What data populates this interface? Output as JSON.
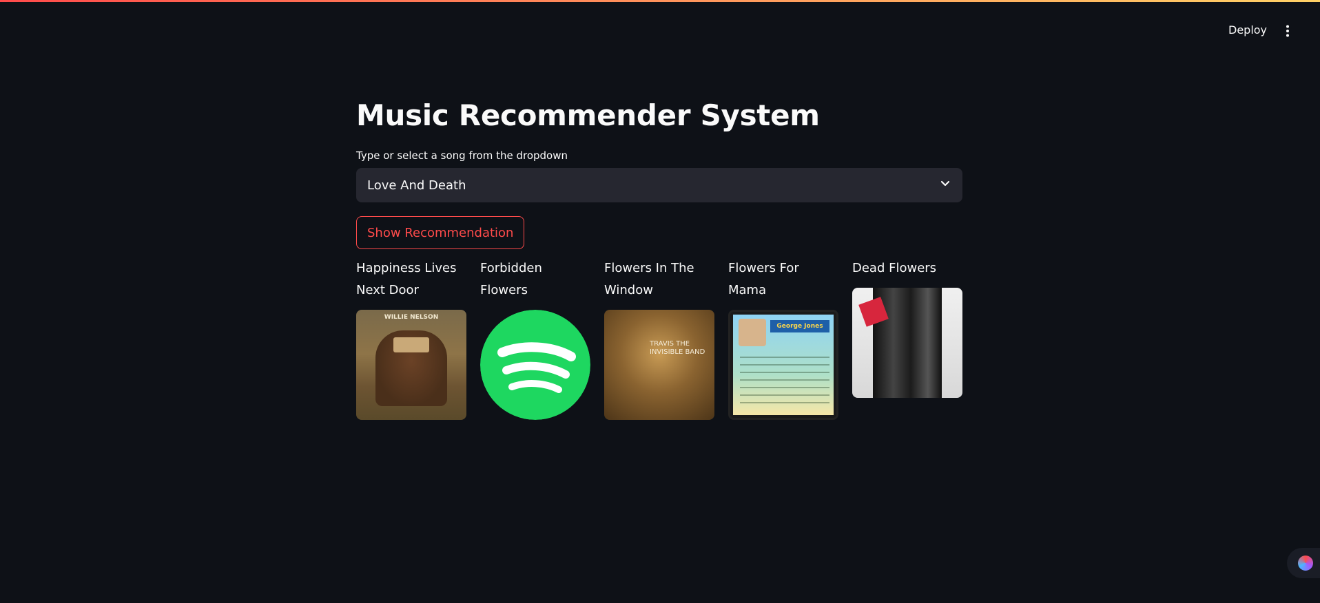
{
  "header": {
    "deploy_label": "Deploy",
    "menu_icon": "vertical-ellipsis-icon"
  },
  "main": {
    "title": "Music Recommender System",
    "select_label": "Type or select a song from the dropdown",
    "select_value": "Love And Death",
    "button_label": "Show Recommendation"
  },
  "recommendations": [
    {
      "title": "Happiness Lives Next Door",
      "cover_text": "WILLIE NELSON"
    },
    {
      "title": "Forbidden Flowers",
      "cover_text": ""
    },
    {
      "title": "Flowers In The Window",
      "cover_text": "TRAVIS THE INVISIBLE BAND"
    },
    {
      "title": "Flowers For Mama",
      "cover_text": "George Jones"
    },
    {
      "title": "Dead Flowers",
      "cover_text": ""
    }
  ],
  "colors": {
    "background": "#0e1117",
    "accent": "#ff4b4b",
    "select_bg": "#262730",
    "spotify_green": "#1ed760"
  }
}
